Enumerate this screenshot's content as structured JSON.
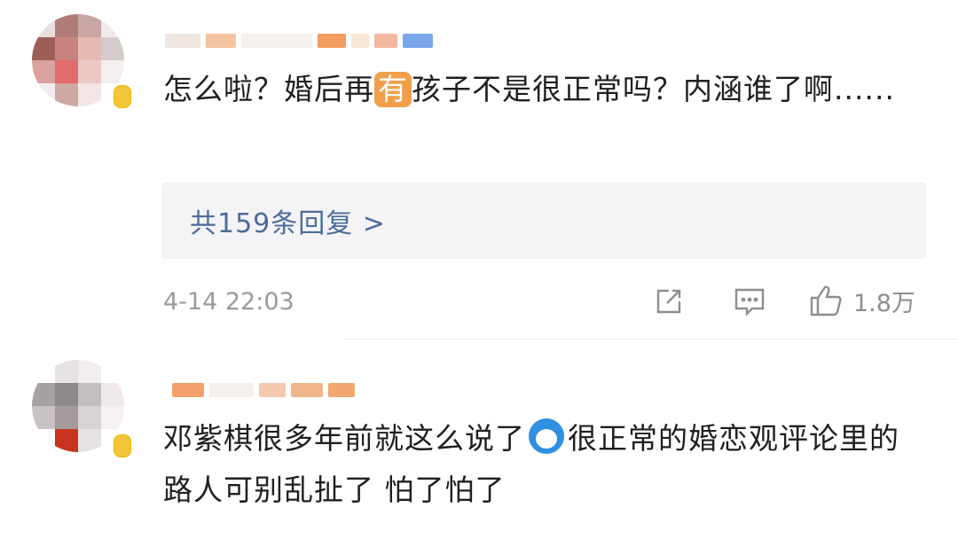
{
  "comments": [
    {
      "text_before": "怎么啦？婚后再",
      "highlight": "有",
      "text_after": "孩子不是很正常吗？内涵谁了啊......",
      "replies_label": "共159条回复 >",
      "timestamp": "4-14 22:03",
      "likes": "1.8万",
      "icons": [
        "share-icon",
        "comment-icon",
        "like-icon"
      ]
    },
    {
      "text_before": "邓紫棋很多年前就这么说了",
      "emoji": "doraemon-emoji",
      "text_after": "很正常的婚恋观评论里的路人可别乱扯了 怕了怕了"
    }
  ],
  "colors": {
    "reply_link": "#4a6c9c",
    "highlight_bg": "#f0a04a",
    "reply_box_bg": "#f4f4f6",
    "meta_gray": "#9a9a9a"
  }
}
